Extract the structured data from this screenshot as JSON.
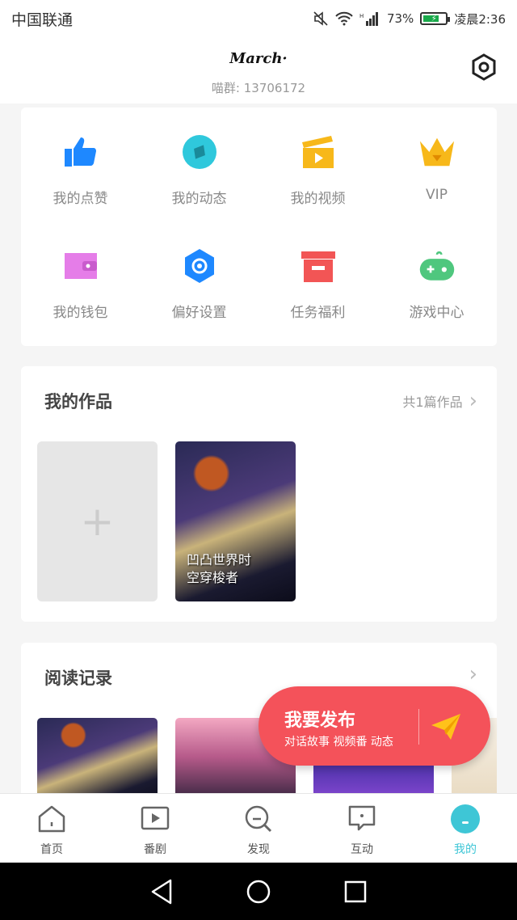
{
  "status": {
    "carrier": "中国联通",
    "battery_pct": "73%",
    "battery_level": 0.73,
    "time": "凌晨2:36"
  },
  "header": {
    "username": "March·",
    "user_id": "喵群: 13706172"
  },
  "grid": [
    {
      "label": "我的点赞",
      "icon": "thumbs-up-icon",
      "color": "#1e88ff"
    },
    {
      "label": "我的动态",
      "icon": "compass-icon",
      "color": "#2fc8dc"
    },
    {
      "label": "我的视频",
      "icon": "clapperboard-icon",
      "color": "#f7b81a"
    },
    {
      "label": "VIP",
      "icon": "crown-icon",
      "color": "#f7b81a"
    },
    {
      "label": "我的钱包",
      "icon": "wallet-icon",
      "color": "#e57de8"
    },
    {
      "label": "偏好设置",
      "icon": "hexagon-gear-icon",
      "color": "#1e88ff"
    },
    {
      "label": "任务福利",
      "icon": "gift-box-icon",
      "color": "#f25555"
    },
    {
      "label": "游戏中心",
      "icon": "gamepad-icon",
      "color": "#4fc77e"
    }
  ],
  "works": {
    "title": "我的作品",
    "count_label": "共1篇作品",
    "add_symbol": "+",
    "items": [
      {
        "title_line1": "凹凸世界时",
        "title_line2": "空穿梭者"
      }
    ]
  },
  "history": {
    "title": "阅读记录"
  },
  "fab": {
    "title": "我要发布",
    "subtitle": "对话故事 视频番 动态"
  },
  "tabs": [
    {
      "label": "首页",
      "icon": "home-icon"
    },
    {
      "label": "番剧",
      "icon": "play-box-icon"
    },
    {
      "label": "发现",
      "icon": "discover-icon"
    },
    {
      "label": "互动",
      "icon": "chat-icon"
    },
    {
      "label": "我的",
      "icon": "profile-icon",
      "active": true
    }
  ],
  "colors": {
    "accent": "#3ec6d6",
    "fab": "#f4525a"
  }
}
